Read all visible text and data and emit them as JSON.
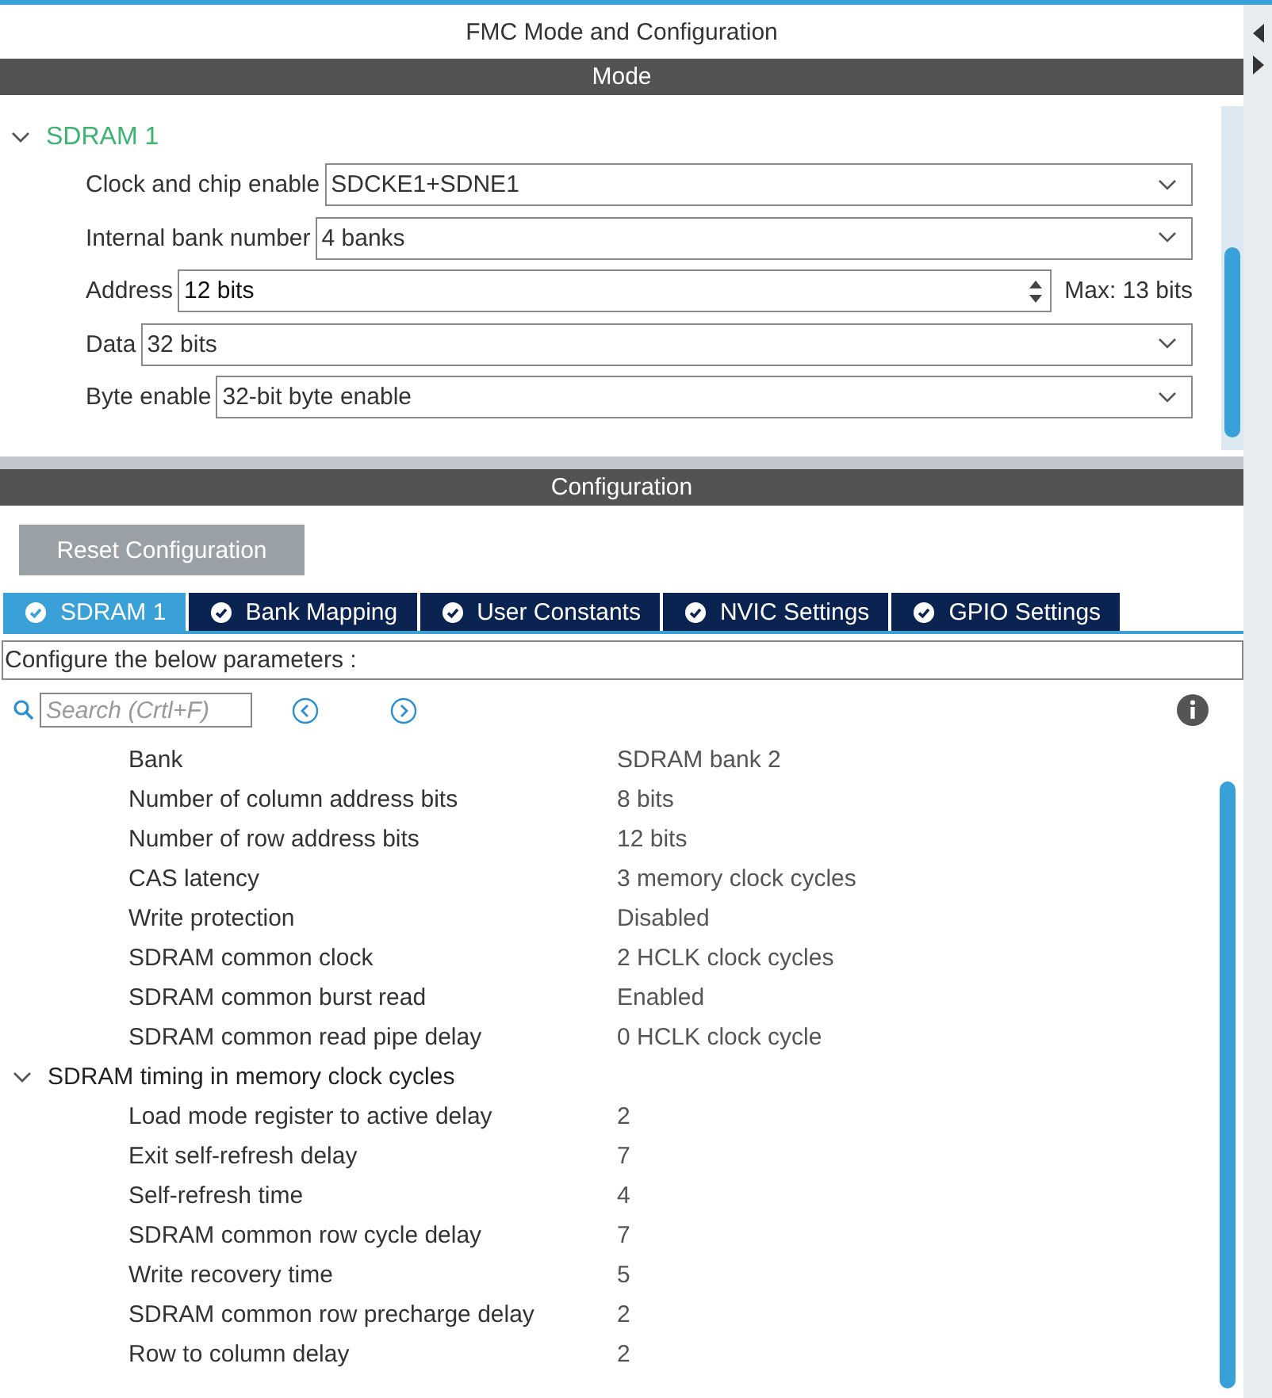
{
  "window": {
    "title": "FMC Mode and Configuration"
  },
  "mode": {
    "header": "Mode",
    "node": {
      "label": "SDRAM 1",
      "expanded": true
    },
    "fields": [
      {
        "kind": "select",
        "label": "Clock and chip enable",
        "value": "SDCKE1+SDNE1"
      },
      {
        "kind": "select",
        "label": "Internal bank number",
        "value": "4 banks"
      },
      {
        "kind": "spinner",
        "label": "Address",
        "value": "12 bits",
        "hint": "Max: 13 bits"
      },
      {
        "kind": "select",
        "label": "Data",
        "value": "32 bits"
      },
      {
        "kind": "select",
        "label": "Byte enable",
        "value": "32-bit byte enable"
      }
    ]
  },
  "configuration": {
    "header": "Configuration",
    "reset_button": "Reset Configuration",
    "tabs": [
      {
        "label": "SDRAM 1",
        "selected": true
      },
      {
        "label": "Bank Mapping",
        "selected": false
      },
      {
        "label": "User Constants",
        "selected": false
      },
      {
        "label": "NVIC Settings",
        "selected": false
      },
      {
        "label": "GPIO Settings",
        "selected": false
      }
    ],
    "description": "Configure the below parameters :",
    "search": {
      "placeholder": "Search (Crtl+F)"
    },
    "parameters": [
      {
        "label": "Bank",
        "value": "SDRAM bank 2"
      },
      {
        "label": "Number of column address bits",
        "value": "8 bits"
      },
      {
        "label": "Number of row address bits",
        "value": "12 bits"
      },
      {
        "label": "CAS latency",
        "value": "3 memory clock cycles"
      },
      {
        "label": "Write protection",
        "value": "Disabled"
      },
      {
        "label": "SDRAM common clock",
        "value": "2 HCLK clock cycles"
      },
      {
        "label": "SDRAM common burst read",
        "value": "Enabled"
      },
      {
        "label": "SDRAM common read pipe delay",
        "value": "0 HCLK clock cycle"
      }
    ],
    "group": {
      "label": "SDRAM timing in memory clock cycles",
      "expanded": true,
      "children": [
        {
          "label": "Load mode register to active delay",
          "value": "2"
        },
        {
          "label": "Exit self-refresh delay",
          "value": "7"
        },
        {
          "label": "Self-refresh time",
          "value": "4"
        },
        {
          "label": "SDRAM common row cycle delay",
          "value": "7"
        },
        {
          "label": "Write recovery time",
          "value": "5"
        },
        {
          "label": "SDRAM common row precharge delay",
          "value": "2"
        },
        {
          "label": "Row to column delay",
          "value": "2"
        }
      ]
    }
  }
}
